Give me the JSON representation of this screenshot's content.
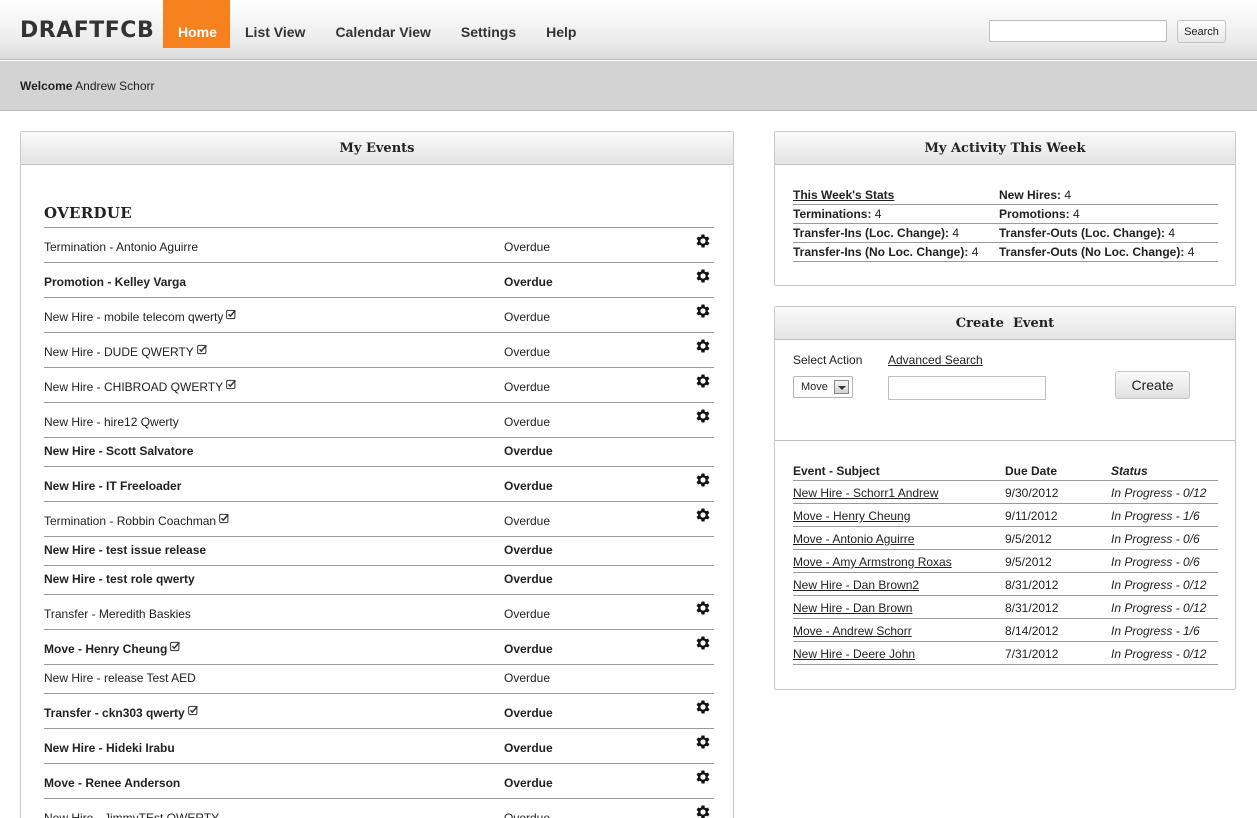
{
  "brand": {
    "logo": "DRAFTFCB",
    "accent": "#f6821f"
  },
  "nav": [
    "Home",
    "List View",
    "Calendar View",
    "Settings",
    "Help"
  ],
  "search": {
    "button": "Search",
    "value": ""
  },
  "welcome": {
    "label": "Welcome",
    "user": "Andrew Schorr"
  },
  "my_events": {
    "title": "My Events",
    "section": "OVERDUE",
    "rows": [
      {
        "name": "Termination - Antonio Aguirre",
        "status": "Overdue",
        "bold": false,
        "check": false,
        "gear": true
      },
      {
        "name": "Promotion - Kelley Varga",
        "status": "Overdue",
        "bold": true,
        "check": false,
        "gear": true
      },
      {
        "name": "New Hire - mobile telecom qwerty",
        "status": "Overdue",
        "bold": false,
        "check": true,
        "gear": true
      },
      {
        "name": "New Hire - DUDE QWERTY",
        "status": "Overdue",
        "bold": false,
        "check": true,
        "gear": true
      },
      {
        "name": "New Hire - CHIBROAD QWERTY",
        "status": "Overdue",
        "bold": false,
        "check": true,
        "gear": true
      },
      {
        "name": "New Hire - hire12 Qwerty",
        "status": "Overdue",
        "bold": false,
        "check": false,
        "gear": true
      },
      {
        "name": "New Hire - Scott Salvatore",
        "status": "Overdue",
        "bold": true,
        "check": false,
        "gear": false
      },
      {
        "name": "New Hire - IT Freeloader",
        "status": "Overdue",
        "bold": true,
        "check": false,
        "gear": true
      },
      {
        "name": "Termination - Robbin Coachman",
        "status": "Overdue",
        "bold": false,
        "check": true,
        "gear": true
      },
      {
        "name": "New Hire - test issue release",
        "status": "Overdue",
        "bold": true,
        "check": false,
        "gear": false
      },
      {
        "name": "New Hire - test role qwerty",
        "status": "Overdue",
        "bold": true,
        "check": false,
        "gear": false
      },
      {
        "name": "Transfer - Meredith Baskies",
        "status": "Overdue",
        "bold": false,
        "check": false,
        "gear": true
      },
      {
        "name": "Move - Henry Cheung",
        "status": "Overdue",
        "bold": true,
        "check": true,
        "gear": true
      },
      {
        "name": "New Hire - release Test AED",
        "status": "Overdue",
        "bold": false,
        "check": false,
        "gear": false
      },
      {
        "name": "Transfer - ckn303 qwerty",
        "status": "Overdue",
        "bold": true,
        "check": true,
        "gear": true
      },
      {
        "name": "New Hire - Hideki Irabu",
        "status": "Overdue",
        "bold": true,
        "check": false,
        "gear": true
      },
      {
        "name": "Move - Renee Anderson",
        "status": "Overdue",
        "bold": true,
        "check": false,
        "gear": true
      },
      {
        "name": "New Hire - JimmyTEst QWERTY",
        "status": "Overdue",
        "bold": false,
        "check": false,
        "gear": true
      }
    ]
  },
  "activity": {
    "title": "My Activity This Week",
    "stats_link": "This Week's Stats",
    "new_hires_label": "New Hires:",
    "new_hires": "4",
    "terminations_label": "Terminations:",
    "terminations": "4",
    "promotions_label": "Promotions:",
    "promotions": "4",
    "transfer_ins_loc_label": "Transfer-Ins (Loc. Change):",
    "transfer_ins_loc": "4",
    "transfer_outs_loc_label": "Transfer-Outs (Loc. Change):",
    "transfer_outs_loc": "4",
    "transfer_ins_noloc_label": "Transfer-Ins (No Loc. Change):",
    "transfer_ins_noloc": "4",
    "transfer_outs_noloc_label": "Transfer-Outs (No Loc. Change):",
    "transfer_outs_noloc": "4"
  },
  "create_event": {
    "title": "Create  Event",
    "select_label": "Select Action",
    "advanced_search": "Advanced Search",
    "select_value": "Move",
    "create_button": "Create",
    "table_headers": [
      "Event - Subject",
      "Due Date",
      "Status"
    ],
    "rows": [
      {
        "subject": "New Hire - Schorr1 Andrew",
        "due": "9/30/2012",
        "status": "In Progress - 0/12"
      },
      {
        "subject": "Move - Henry Cheung",
        "due": "9/11/2012",
        "status": "In Progress - 1/6"
      },
      {
        "subject": "Move - Antonio Aguirre",
        "due": "9/5/2012",
        "status": "In Progress - 0/6"
      },
      {
        "subject": "Move - Amy Armstrong Roxas",
        "due": "9/5/2012",
        "status": "In Progress - 0/6"
      },
      {
        "subject": "New Hire - Dan Brown2",
        "due": "8/31/2012",
        "status": "In Progress - 0/12"
      },
      {
        "subject": "New Hire - Dan Brown",
        "due": "8/31/2012",
        "status": "In Progress - 0/12"
      },
      {
        "subject": "Move - Andrew Schorr",
        "due": "8/14/2012",
        "status": "In Progress - 1/6"
      },
      {
        "subject": "New Hire - Deere John",
        "due": "7/31/2012",
        "status": "In Progress - 0/12"
      }
    ]
  }
}
